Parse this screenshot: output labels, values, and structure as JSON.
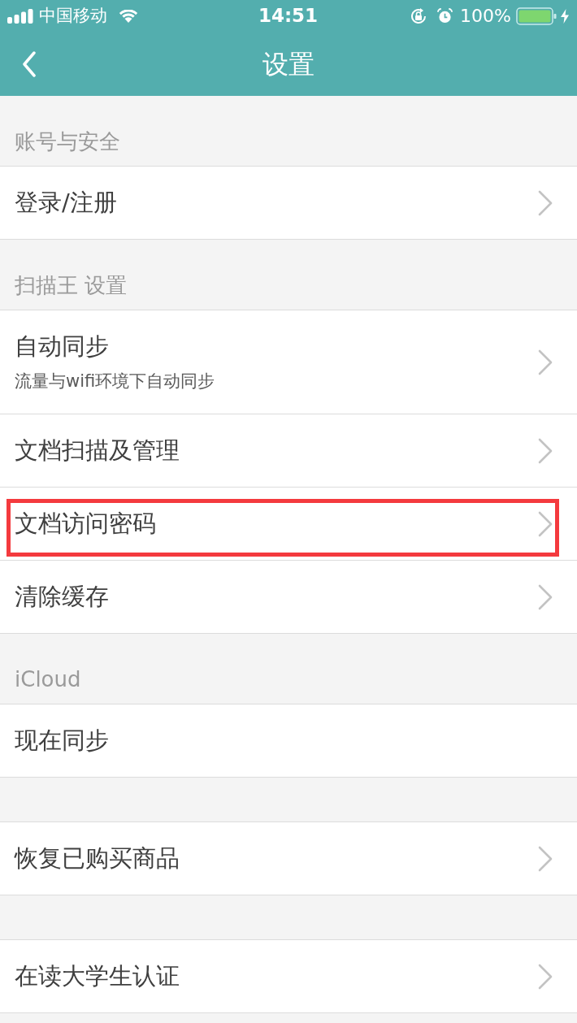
{
  "status_bar": {
    "carrier": "中国移动",
    "time": "14:51",
    "battery": "100%"
  },
  "nav_bar": {
    "title": "设置"
  },
  "sections": [
    {
      "title": "账号与安全",
      "items": [
        {
          "label": "登录/注册",
          "chevron": true,
          "highlighted": false
        }
      ]
    },
    {
      "title": "扫描王 设置",
      "items": [
        {
          "label": "自动同步",
          "subtitle": "流量与wifi环境下自动同步",
          "chevron": true,
          "highlighted": false
        },
        {
          "label": "文档扫描及管理",
          "chevron": true,
          "highlighted": false
        },
        {
          "label": "文档访问密码",
          "chevron": true,
          "highlighted": true
        },
        {
          "label": "清除缓存",
          "chevron": true,
          "highlighted": false
        }
      ]
    },
    {
      "title": "iCloud",
      "items": [
        {
          "label": "现在同步",
          "chevron": false,
          "highlighted": false
        }
      ]
    },
    {
      "items": [
        {
          "label": "恢复已购买商品",
          "chevron": true,
          "highlighted": false
        }
      ]
    },
    {
      "items": [
        {
          "label": "在读大学生认证",
          "chevron": true,
          "highlighted": false
        }
      ]
    }
  ]
}
